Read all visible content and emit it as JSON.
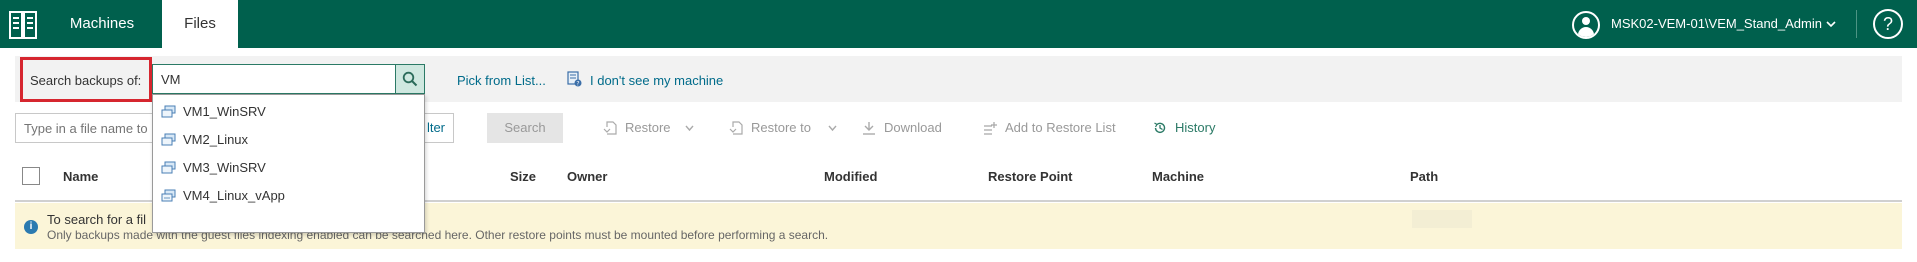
{
  "header": {
    "tabs": [
      {
        "label": "Machines",
        "active": false
      },
      {
        "label": "Files",
        "active": true
      }
    ],
    "user": "MSK02-VEM-01\\VEM_Stand_Admin",
    "help_label": "?",
    "colors": {
      "bar": "#00604d",
      "text": "#ffffff"
    }
  },
  "search": {
    "label": "Search backups of:",
    "value": "VM",
    "pick_link": "Pick from List...",
    "machine_link": "I don't see my machine",
    "dropdown": [
      {
        "label": "VM1_WinSRV",
        "icon": "vm-icon"
      },
      {
        "label": "VM2_Linux",
        "icon": "vm-icon"
      },
      {
        "label": "VM3_WinSRV",
        "icon": "vm-icon"
      },
      {
        "label": "VM4_Linux_vApp",
        "icon": "vapp-icon"
      }
    ]
  },
  "toolbar": {
    "filename_placeholder": "Type in a file name to",
    "filter_label": "lter",
    "search_label": "Search",
    "restore_label": "Restore",
    "restore_to_label": "Restore to",
    "download_label": "Download",
    "add_label": "Add to Restore List",
    "history_label": "History"
  },
  "table": {
    "columns": [
      "Name",
      "Size",
      "Owner",
      "Modified",
      "Restore Point",
      "Machine",
      "Path"
    ]
  },
  "info": {
    "title": "To search for a fil",
    "detail": "Only backups made with the guest files indexing enabled can be searched here. Other restore points must be mounted before performing a search.",
    "icon": "info-icon"
  },
  "colors": {
    "accent": "#00604d",
    "link": "#006b8a",
    "highlight_border": "#d6262f",
    "info_background": "#fbf5d8"
  }
}
